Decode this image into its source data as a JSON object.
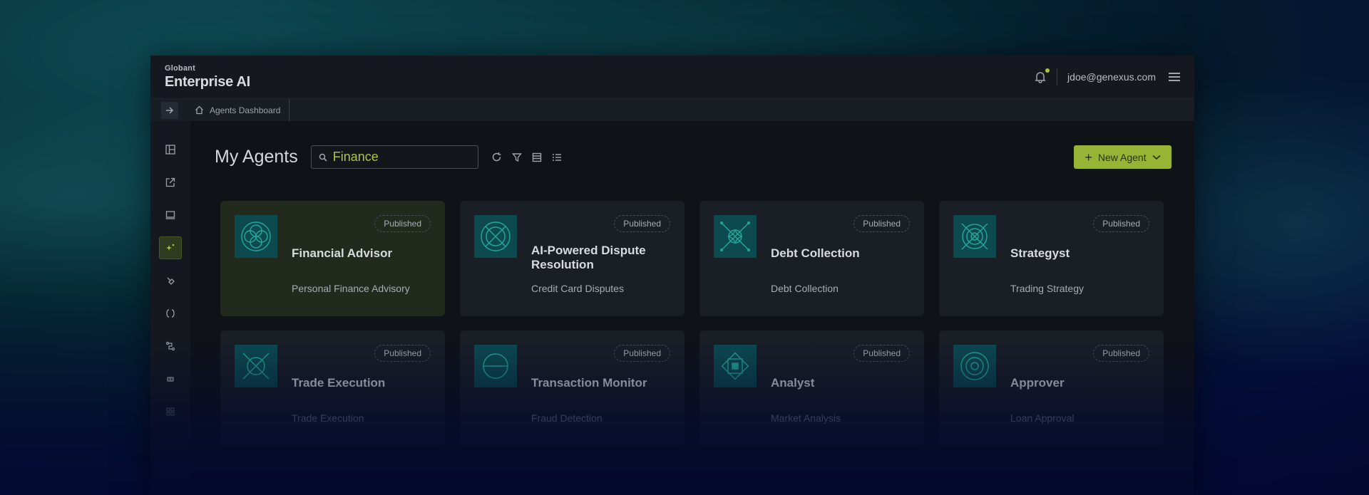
{
  "brand": {
    "company": "Globant",
    "product": "Enterprise AI"
  },
  "header": {
    "user_email": "jdoe@genexus.com"
  },
  "breadcrumb": {
    "label": "Agents Dashboard"
  },
  "sidebar": {
    "items": [
      {
        "icon": "dashboard-icon"
      },
      {
        "icon": "external-link-icon"
      },
      {
        "icon": "monitor-icon"
      },
      {
        "icon": "agents-sparkle-icon",
        "active": true
      },
      {
        "icon": "tools-icon"
      },
      {
        "icon": "code-brackets-icon"
      },
      {
        "icon": "flow-icon"
      },
      {
        "icon": "robot-icon"
      },
      {
        "icon": "grid-icon"
      }
    ]
  },
  "main": {
    "title": "My Agents",
    "search_value": "Finance",
    "new_agent_label": "New Agent"
  },
  "colors": {
    "accent": "#98b435",
    "teal": "#0d4a50"
  },
  "cards": [
    {
      "status": "Published",
      "title": "Financial Advisor",
      "subtitle": "Personal Finance Advisory",
      "icon": "rings-icon"
    },
    {
      "status": "Published",
      "title": "AI-Powered Dispute Resolution",
      "subtitle": "Credit Card Disputes",
      "icon": "crossed-circle-icon"
    },
    {
      "status": "Published",
      "title": "Debt Collection",
      "subtitle": "Debt Collection",
      "icon": "star-cross-icon"
    },
    {
      "status": "Published",
      "title": "Strategyst",
      "subtitle": "Trading Strategy",
      "icon": "target-cross-icon"
    },
    {
      "status": "Published",
      "title": "Trade Execution",
      "subtitle": "Trade Execution",
      "icon": "cross-arrows-icon"
    },
    {
      "status": "Published",
      "title": "Transaction Monitor",
      "subtitle": "Fraud Detection",
      "icon": "spiral-icon"
    },
    {
      "status": "Published",
      "title": "Analyst",
      "subtitle": "Market Analysis",
      "icon": "chip-icon"
    },
    {
      "status": "Published",
      "title": "Approver",
      "subtitle": "Loan Approval",
      "icon": "concentric-icon"
    }
  ]
}
